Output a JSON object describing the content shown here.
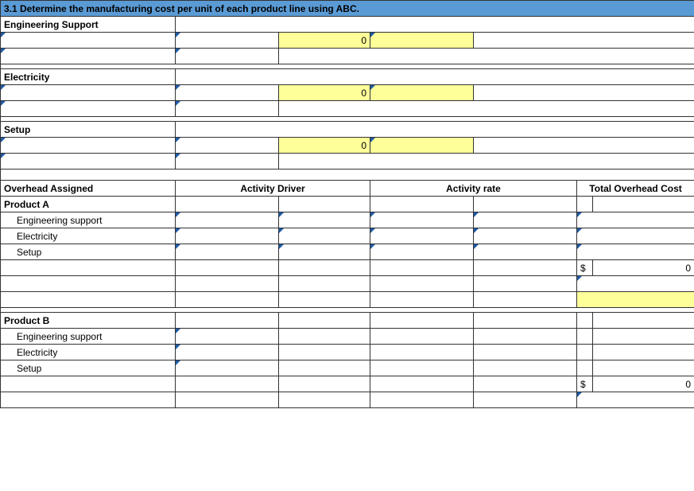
{
  "title": "3.1  Determine the manufacturing cost per unit of each product line using ABC.",
  "sections": {
    "engSupport": "Engineering Support",
    "electricity": "Electricity",
    "setup": "Setup"
  },
  "zero": "0",
  "table2": {
    "h1": "Overhead Assigned",
    "h2": "Activity Driver",
    "h3": "Activity rate",
    "h4": "Total Overhead Cost"
  },
  "productA": {
    "label": "Product A",
    "r1": "Engineering support",
    "r2": "Electricity",
    "r3": "Setup"
  },
  "productB": {
    "label": "Product B",
    "r1": "Engineering support",
    "r2": "Electricity",
    "r3": "Setup"
  },
  "currency": "$",
  "totalA": "0",
  "totalB": "0"
}
